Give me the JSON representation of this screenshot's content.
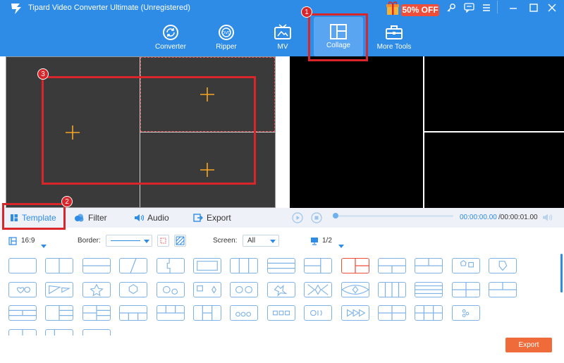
{
  "app": {
    "title": "Tipard Video Converter Ultimate (Unregistered)",
    "promo": "50% OFF"
  },
  "nav": [
    {
      "label": "Converter",
      "icon": "converter-icon"
    },
    {
      "label": "Ripper",
      "icon": "dvd-icon"
    },
    {
      "label": "MV",
      "icon": "tv-icon"
    },
    {
      "label": "Collage",
      "icon": "collage-icon",
      "active": true
    },
    {
      "label": "More Tools",
      "icon": "toolbox-icon"
    }
  ],
  "tabs": [
    {
      "label": "Template",
      "icon": "template-icon"
    },
    {
      "label": "Filter",
      "icon": "filter-icon"
    },
    {
      "label": "Audio",
      "icon": "audio-icon"
    },
    {
      "label": "Export",
      "icon": "export-icon"
    }
  ],
  "player": {
    "time_current": "00:00:00.00",
    "time_total": "/00:00:01.00"
  },
  "options": {
    "ratio": "16:9",
    "border_label": "Border:",
    "screen_label": "Screen:",
    "screen_value": "All",
    "page": "1/2"
  },
  "annotations": [
    "1",
    "2",
    "3"
  ],
  "export_label": "Export",
  "colors": {
    "header": "#2e8be6",
    "accent": "#ef6c3a",
    "highlight": "#d8262a"
  }
}
